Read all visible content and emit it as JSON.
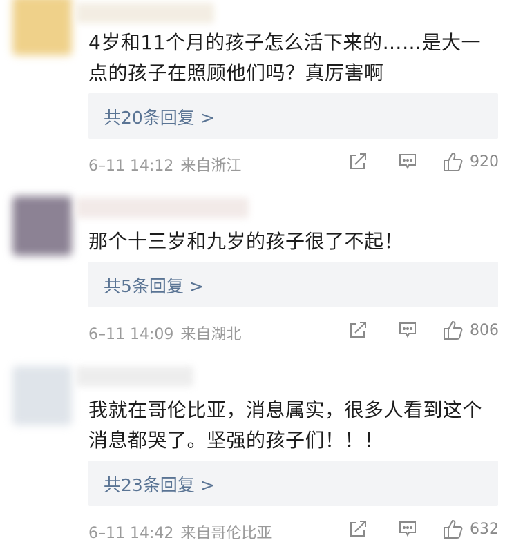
{
  "comments": [
    {
      "text_lines": [
        "4岁和11个月的孩子怎么活下来的……是大一",
        "点的孩子在照顾他们吗？真厉害啊"
      ],
      "replies": "共20条回复 >",
      "time": "6–11 14:12",
      "location": "来自浙江",
      "likes": "920",
      "avatar_color": "#efd18a",
      "name_color": "#f2ece0"
    },
    {
      "text_lines": [
        "那个十三岁和九岁的孩子很了不起！"
      ],
      "replies": "共5条回复 >",
      "time": "6–11 14:09",
      "location": "来自湖北",
      "likes": "806",
      "avatar_color": "#8c8294",
      "name_color": "#f1e8e6"
    },
    {
      "text_lines": [
        "我就在哥伦比亚，消息属实，很多人看到这个",
        "消息都哭了。坚强的孩子们！！！"
      ],
      "replies": "共23条回复 >",
      "time": "6–11 14:42",
      "location": "来自哥伦比亚",
      "likes": "632",
      "avatar_color": "#dfe4ea",
      "name_color": "#ececec"
    }
  ],
  "icons": {
    "share": "share-icon",
    "comment": "comment-icon",
    "like": "thumbs-up-icon"
  }
}
